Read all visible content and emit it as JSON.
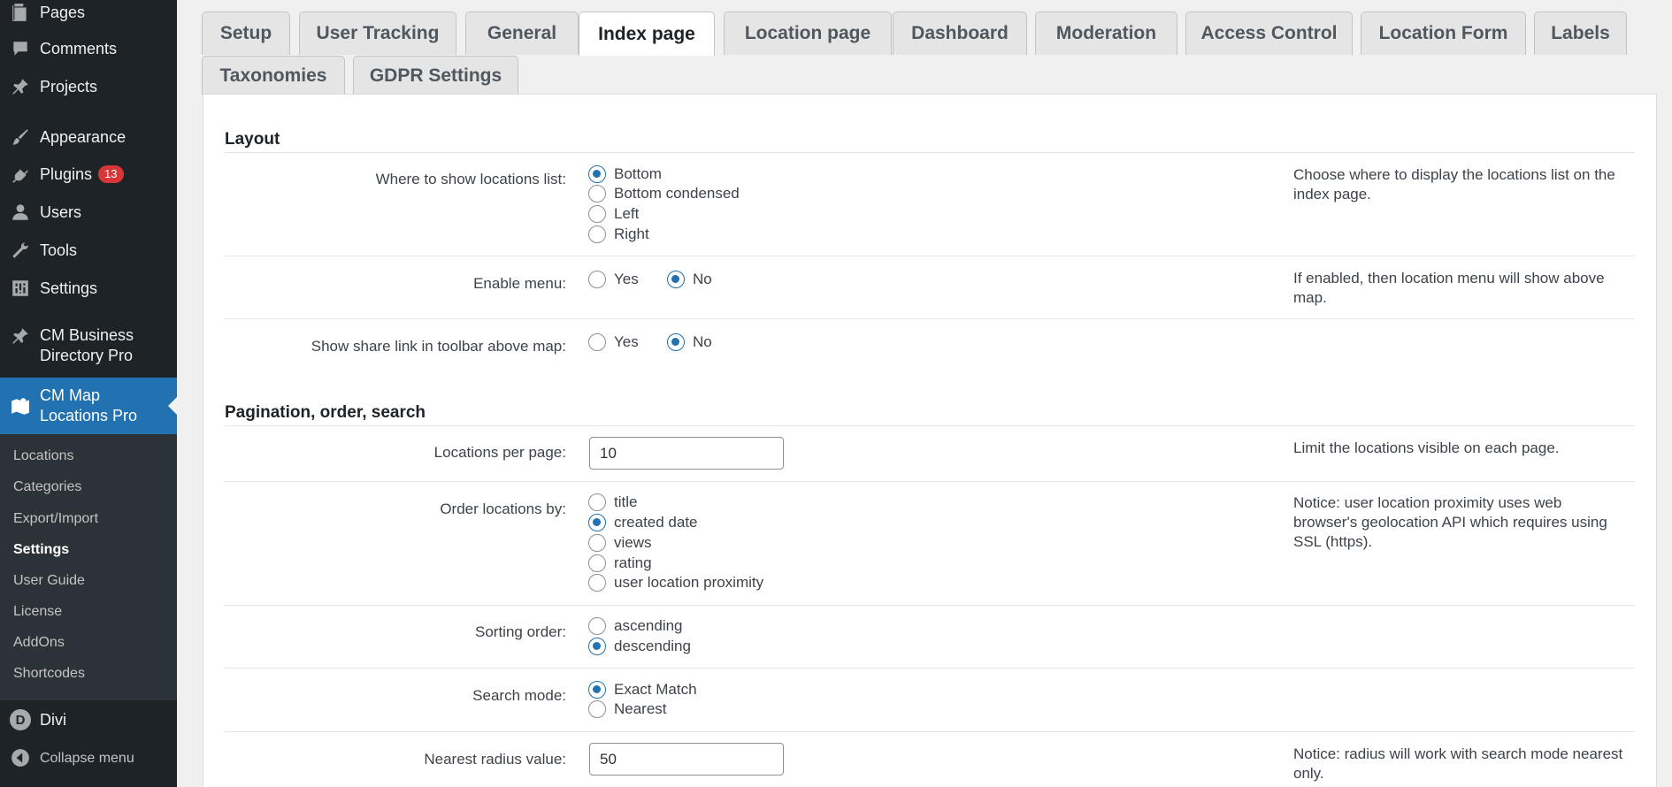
{
  "sidebar": {
    "items": [
      {
        "label": "Pages",
        "icon": "pages-icon"
      },
      {
        "label": "Comments",
        "icon": "comments-icon"
      },
      {
        "label": "Projects",
        "icon": "pin-icon"
      },
      {
        "label": "Appearance",
        "icon": "brush-icon"
      },
      {
        "label": "Plugins",
        "icon": "plugin-icon",
        "badge": "13"
      },
      {
        "label": "Users",
        "icon": "user-icon"
      },
      {
        "label": "Tools",
        "icon": "wrench-icon"
      },
      {
        "label": "Settings",
        "icon": "settings-icon"
      },
      {
        "label": "CM Business Directory Pro",
        "icon": "pin-icon"
      },
      {
        "label": "CM Map Locations Pro",
        "icon": "map-icon"
      }
    ],
    "submenu": [
      "Locations",
      "Categories",
      "Export/Import",
      "Settings",
      "User Guide",
      "License",
      "AddOns",
      "Shortcodes"
    ],
    "submenu_active": "Settings",
    "divi": {
      "label": "Divi",
      "logo": "D"
    },
    "collapse": "Collapse menu"
  },
  "tabs": {
    "row1": [
      "Setup",
      "User Tracking",
      "General",
      "Index page",
      "Location page",
      "Dashboard",
      "Moderation",
      "Access Control",
      "Location Form",
      "Labels"
    ],
    "row2": [
      "Taxonomies",
      "GDPR Settings"
    ],
    "active": "Index page"
  },
  "layout_section": {
    "title": "Layout",
    "locations_list": {
      "label": "Where to show locations list:",
      "options": [
        "Bottom",
        "Bottom condensed",
        "Left",
        "Right"
      ],
      "selected": "Bottom",
      "help": "Choose where to display the locations list on the index page."
    },
    "enable_menu": {
      "label": "Enable menu:",
      "options": [
        "Yes",
        "No"
      ],
      "selected": "No",
      "help": "If enabled, then location menu will show above map."
    },
    "share_link": {
      "label": "Show share link in toolbar above map:",
      "options": [
        "Yes",
        "No"
      ],
      "selected": "No"
    }
  },
  "pagination_section": {
    "title": "Pagination, order, search",
    "per_page": {
      "label": "Locations per page:",
      "value": "10",
      "help": "Limit the locations visible on each page."
    },
    "order_by": {
      "label": "Order locations by:",
      "options": [
        "title",
        "created date",
        "views",
        "rating",
        "user location proximity"
      ],
      "selected": "created date",
      "help": "Notice: user location proximity uses web browser's geolocation API which requires using SSL (https)."
    },
    "sorting": {
      "label": "Sorting order:",
      "options": [
        "ascending",
        "descending"
      ],
      "selected": "descending"
    },
    "search_mode": {
      "label": "Search mode:",
      "options": [
        "Exact Match",
        "Nearest"
      ],
      "selected": "Exact Match"
    },
    "radius": {
      "label": "Nearest radius value:",
      "value": "50",
      "help": "Notice: radius will work with search mode nearest only."
    }
  },
  "colors": {
    "sidebar_bg": "#1d2327",
    "accent": "#2271b1",
    "badge": "#d63638"
  }
}
